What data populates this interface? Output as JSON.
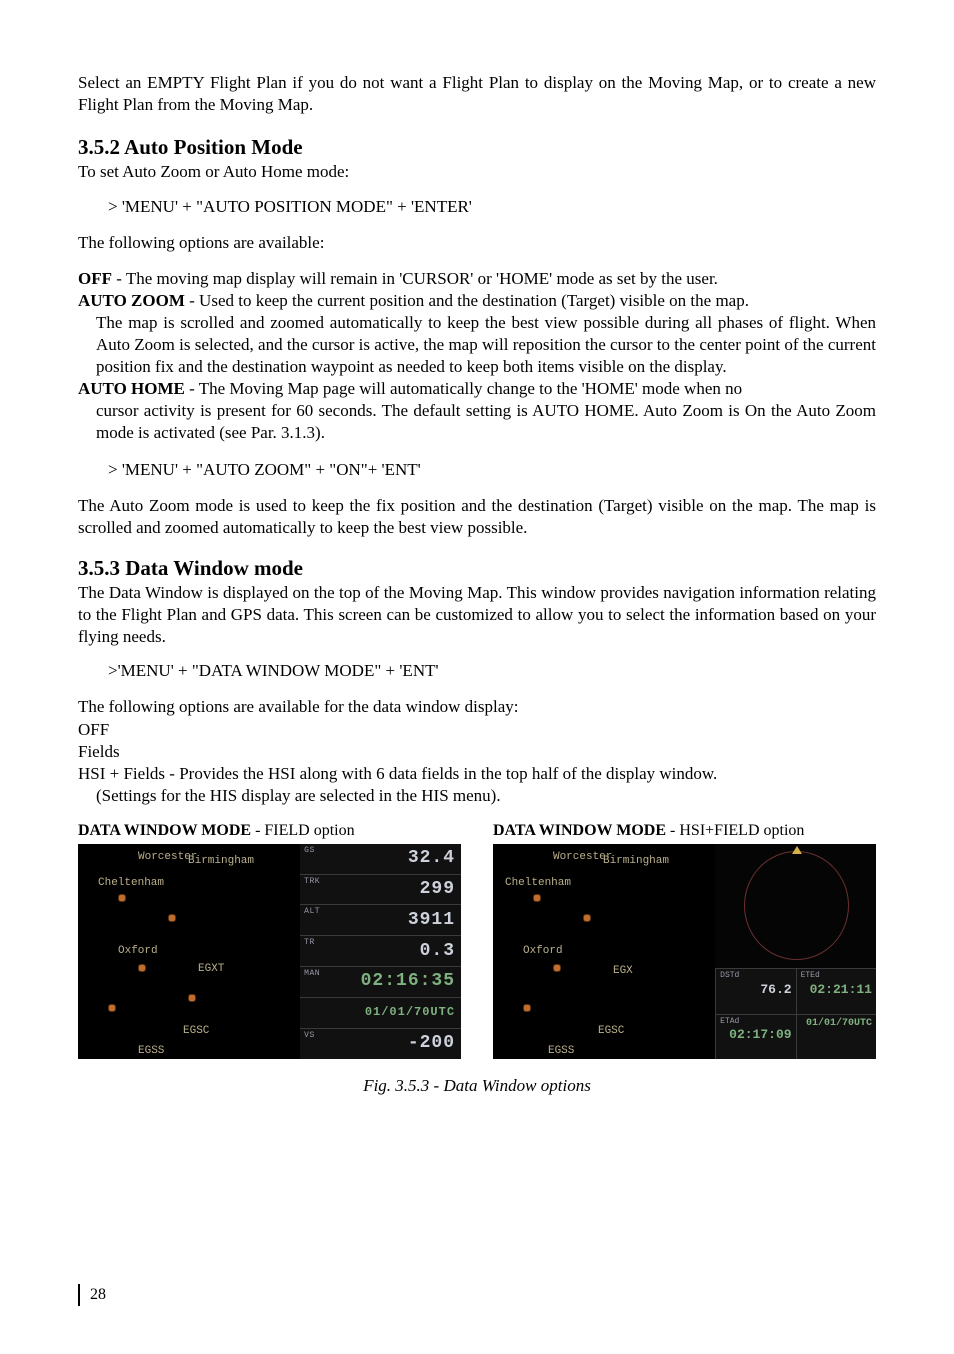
{
  "intro": "Select an EMPTY Flight Plan if you do not want a Flight Plan to display on the Moving Map, or to create a new Flight Plan from the Moving Map.",
  "s352": {
    "heading": "3.5.2  Auto Position Mode",
    "sub": "To set Auto Zoom or Auto Home mode:",
    "cmd1": "> 'MENU' + \"AUTO POSITION MODE\" + 'ENTER'",
    "avail": "The following options are available:",
    "off_label": "OFF",
    "off_text": " - The moving map display will remain in 'CURSOR' or 'HOME' mode as set by the user.",
    "az_label": "AUTO ZOOM",
    "az_text": " - Used to keep the current position and the destination (Target) visible on the map.",
    "az_cont": "The map is scrolled and zoomed automatically to keep the best view possible during all phases of flight. When Auto Zoom is selected, and the cursor is active, the map will reposition the cursor to the center point of the current position fix and the destination waypoint as needed to keep both items visible on the display.",
    "ah_label": "AUTO HOME",
    "ah_text": " - The Moving Map page will automatically change to the 'HOME' mode when no",
    "ah_cont": "cursor activity is present for 60 seconds. The default setting is AUTO HOME. Auto Zoom is On the Auto Zoom mode is activated (see Par. 3.1.3).",
    "cmd2": "> 'MENU' + \"AUTO ZOOM\" + \"ON\"+ 'ENT'",
    "tail": "The Auto Zoom mode is used to keep the fix position and the destination (Target) visible on the map. The map is scrolled and zoomed automatically to keep the best view possible."
  },
  "s353": {
    "heading": "3.5.3  Data Window mode",
    "intro": "The Data Window is displayed on the top of the Moving Map. This window provides navigation information relating to the Flight Plan and GPS data. This screen can be customized to allow you to select the information based on your flying needs.",
    "cmd": ">'MENU' + \"DATA WINDOW MODE\" + 'ENT'",
    "opts_intro": "The following options are available for the data window display:",
    "opt_off": "OFF",
    "opt_fields": "Fields",
    "opt_hsi": "HSI + Fields - Provides the HSI along with 6 data fields in the top half of the display window.",
    "opt_his_cont": "(Settings for the HIS display are selected in the HIS menu)."
  },
  "fig": {
    "caption": "Fig. 3.5.3 - Data Window options",
    "left": {
      "title_bold": "DATA WINDOW MODE",
      "title_rest": " - FIELD option",
      "rows": [
        {
          "lbl": "GS",
          "val": "32.4"
        },
        {
          "lbl": "TRK",
          "val": "299"
        },
        {
          "lbl": "ALT",
          "val": "3911"
        },
        {
          "lbl": "TR",
          "val": "0.3"
        },
        {
          "lbl": "MAN",
          "val": "02:16:35"
        },
        {
          "lbl": "",
          "val": "01/01/70UTC"
        },
        {
          "lbl": "VS",
          "val": "-200"
        }
      ],
      "towns": [
        "Worcester",
        "Birmingham",
        "Cheltenham",
        "Oxford",
        "EGXT",
        "EGSC",
        "EGSS"
      ]
    },
    "right": {
      "title_bold": "DATA WINDOW MODE",
      "title_rest": " - HSI+FIELD option",
      "cells": [
        {
          "lbl": "DSTd",
          "val": "76.2"
        },
        {
          "lbl": "ETEd",
          "val": "02:21:11"
        },
        {
          "lbl": "ETAd",
          "val": "02:17:09"
        },
        {
          "lbl": "",
          "val": "01/01/70UTC"
        }
      ],
      "towns": [
        "Worcester",
        "Birmingham",
        "Cheltenham",
        "Oxford",
        "EGX",
        "EGSC",
        "EGSS"
      ]
    }
  },
  "page_number": "28"
}
